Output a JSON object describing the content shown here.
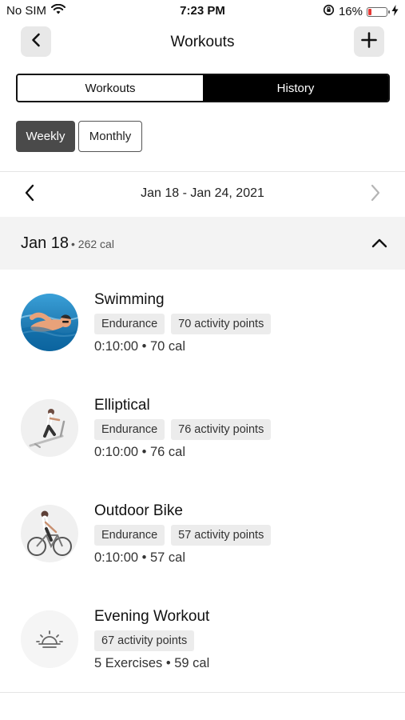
{
  "status_bar": {
    "carrier": "No SIM",
    "time": "7:23 PM",
    "battery_percent": "16%",
    "battery_level": 0.16,
    "battery_color": "#e53935"
  },
  "header": {
    "title": "Workouts",
    "back_icon": "chevron-left-icon",
    "add_icon": "plus-icon"
  },
  "tabs": [
    {
      "label": "Workouts",
      "selected": false
    },
    {
      "label": "History",
      "selected": true
    }
  ],
  "period": {
    "weekly": "Weekly",
    "monthly": "Monthly",
    "selected": "Weekly"
  },
  "date_nav": {
    "range": "Jan 18 - Jan 24, 2021",
    "prev_icon": "chevron-left-icon",
    "next_icon": "chevron-right-icon"
  },
  "day": {
    "title": "Jan 18",
    "calories": "• 262 cal",
    "collapse_icon": "chevron-up-icon"
  },
  "workouts": [
    {
      "name": "Swimming",
      "type": "Endurance",
      "points": "70 activity points",
      "meta": "0:10:00 • 70 cal",
      "image": "swimmer-photo"
    },
    {
      "name": "Elliptical",
      "type": "Endurance",
      "points": "76 activity points",
      "meta": "0:10:00 • 76 cal",
      "image": "elliptical-photo"
    },
    {
      "name": "Outdoor Bike",
      "type": "Endurance",
      "points": "57 activity points",
      "meta": "0:10:00 • 57 cal",
      "image": "cyclist-photo"
    },
    {
      "name": "Evening Workout",
      "points": "67 activity points",
      "meta": "5 Exercises • 59 cal",
      "image": "sunset-icon"
    }
  ]
}
